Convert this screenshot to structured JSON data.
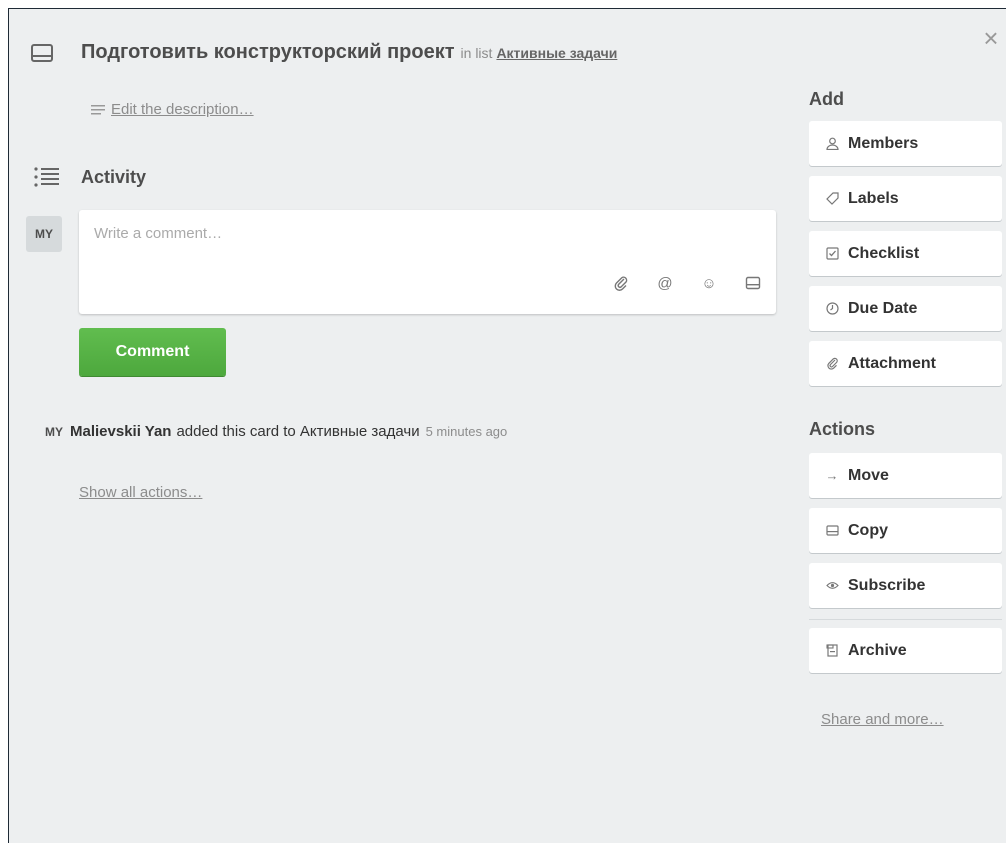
{
  "card": {
    "title": "Подготовить конструкторский проект",
    "in_list_text": "in list",
    "list_name": "Активные задачи",
    "close_symbol": "×"
  },
  "description": {
    "link_text": "Edit the description…"
  },
  "activity": {
    "title": "Activity",
    "avatar_initials": "MY",
    "comment_placeholder": "Write a comment…",
    "comment_button": "Comment",
    "tools": [
      "attachment-icon",
      "mention-icon",
      "emoji-icon",
      "card-icon"
    ],
    "tool_glyphs": {
      "mention": "@",
      "emoji": "☺"
    },
    "items": [
      {
        "avatar": "MY",
        "user": "Malievskii Yan",
        "text": "added this card to Активные задачи",
        "time": "5 minutes ago"
      }
    ],
    "show_all": "Show all actions…"
  },
  "sidebar": {
    "add_title": "Add",
    "add_buttons": [
      {
        "label": "Members",
        "icon": "person-icon"
      },
      {
        "label": "Labels",
        "icon": "tag-icon"
      },
      {
        "label": "Checklist",
        "icon": "checkbox-icon"
      },
      {
        "label": "Due Date",
        "icon": "clock-icon"
      },
      {
        "label": "Attachment",
        "icon": "paperclip-icon"
      }
    ],
    "actions_title": "Actions",
    "action_buttons": [
      {
        "label": "Move",
        "icon": "arrow-right-icon",
        "glyph": "→"
      },
      {
        "label": "Copy",
        "icon": "copy-icon"
      },
      {
        "label": "Subscribe",
        "icon": "eye-icon"
      },
      {
        "label": "Archive",
        "icon": "archive-icon"
      }
    ],
    "share_link": "Share and more…"
  },
  "colors": {
    "background": "#edeff0",
    "comment_button": "#5aac44",
    "text": "#4d4d4d",
    "muted": "#8c8c8c"
  }
}
